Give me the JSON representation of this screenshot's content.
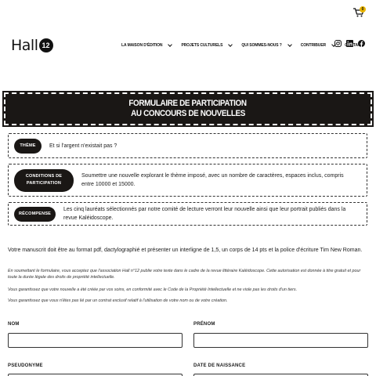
{
  "header": {
    "cart_count": "0",
    "logo_text": "Hall",
    "logo_number": "12",
    "nav": [
      {
        "label": "La maison d'édition"
      },
      {
        "label": "Projets culturels"
      },
      {
        "label": "Qui sommes-nous ?"
      },
      {
        "label": "Contribuer"
      },
      {
        "label": "Contact"
      }
    ],
    "social": [
      "instagram-icon",
      "linkedin-icon",
      "facebook-icon"
    ]
  },
  "banner": {
    "line1": "Formulaire de participation",
    "line2": "au concours de nouvelles"
  },
  "info": [
    {
      "tag": "Thème",
      "text": "Et si l'argent n'existait pas ?"
    },
    {
      "tag": "Conditions de participation",
      "text": "Soumettre une nouvelle explorant le thème imposé, avec un nombre de caractères, espaces inclus, compris entre 10000 et 15000."
    },
    {
      "tag": "Récompense",
      "text": "Les cinq lauréats sélectionnés par notre comité de lecture verront leur nouvelle ainsi que leur portrait publiés dans la revue Kaléidoscope."
    }
  ],
  "paragraphs": {
    "main": "Votre manuscrit doit être au format pdf, dactylographié et présenter un interligne de 1,5, un corps de 14 pts et la police d'écriture Tim New Roman.",
    "consent": "En soumettant le formulaire, vous acceptez que l'association Hall n°12 publie votre texte dans le cadre de la revue littéraire Kaléidoscope. Cette autorisation est donnée à titre gratuit et pour toute la durée légale des droits de propriété intellectuelle.",
    "guarantee1": "Vous garantissez que votre nouvelle a été créée par vos soins, en conformité avec le Code de la Propriété Intellectuelle et ne viole pas les droits d'un tiers.",
    "guarantee2": "Vous garantissez que vous n'êtes pas lié par un contrat exclusif relatif à l'utilisation de votre nom ou de votre création."
  },
  "form": {
    "nom_label": "Nom",
    "prenom_label": "Prénom",
    "pseudonyme_label": "Pseudonyme",
    "date_label": "Date de naissance"
  },
  "colors": {
    "dark": "#1a1715",
    "accent": "#e8b400"
  }
}
